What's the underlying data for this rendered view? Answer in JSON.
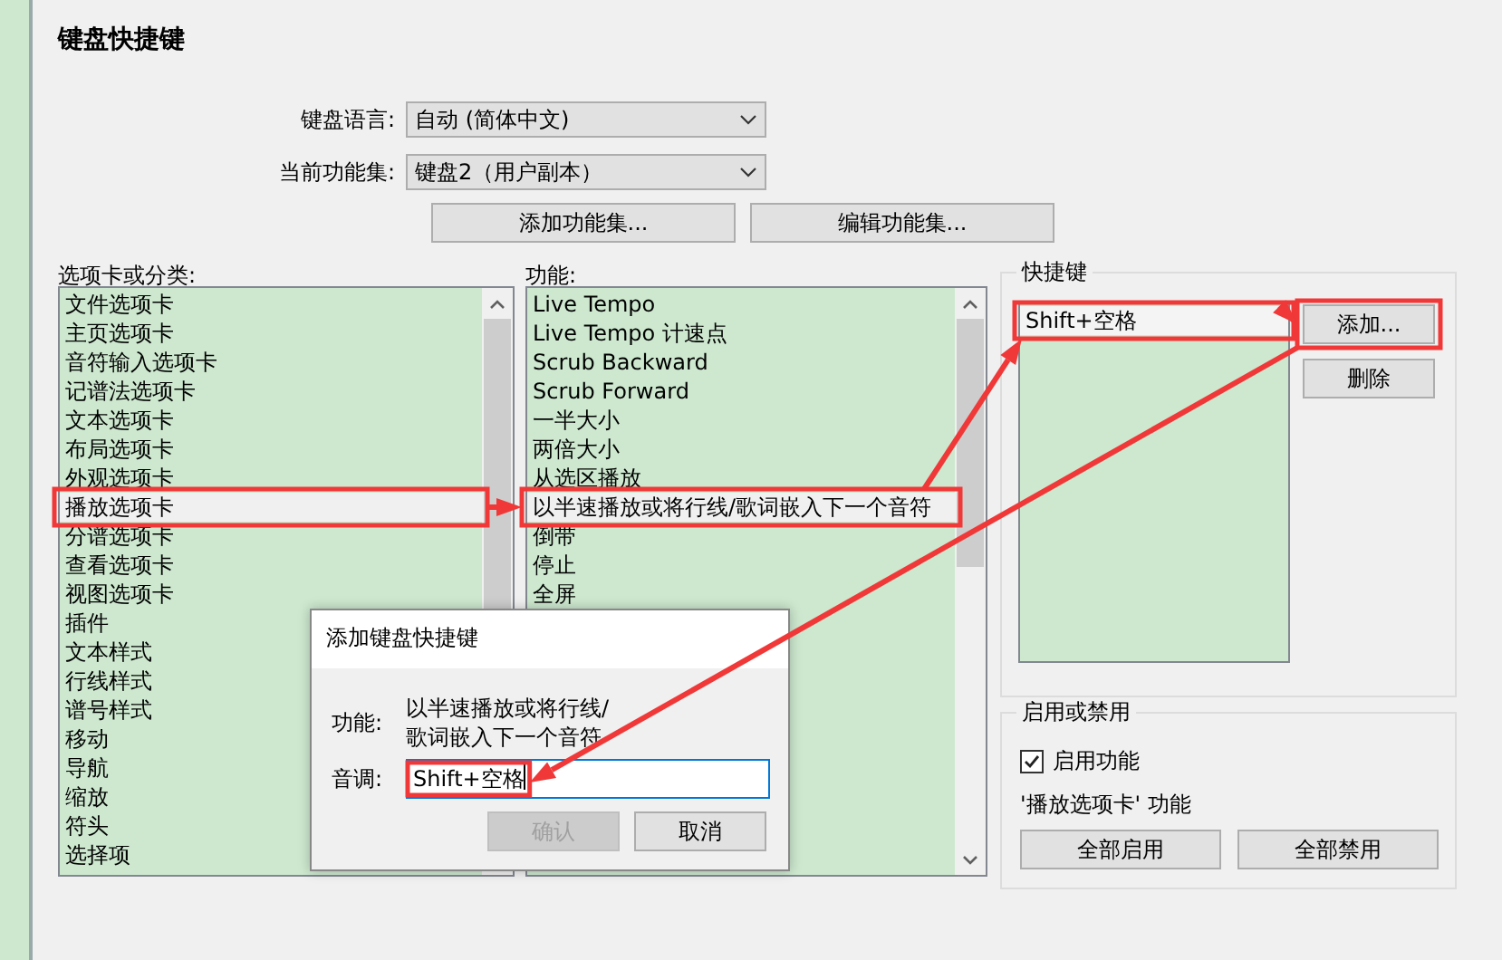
{
  "title": "键盘快捷键",
  "keyboard_language": {
    "label": "键盘语言:",
    "value": "自动 (简体中文)"
  },
  "feature_set": {
    "label": "当前功能集:",
    "value": "键盘2（用户副本）"
  },
  "feature_set_buttons": [
    "添加功能集...",
    "编辑功能集..."
  ],
  "categories": {
    "label": "选项卡或分类:",
    "items": [
      {
        "text": "文件选项卡",
        "selected": false
      },
      {
        "text": "主页选项卡",
        "selected": false
      },
      {
        "text": "音符输入选项卡",
        "selected": false
      },
      {
        "text": "记谱法选项卡",
        "selected": false
      },
      {
        "text": "文本选项卡",
        "selected": false
      },
      {
        "text": "布局选项卡",
        "selected": false
      },
      {
        "text": "外观选项卡",
        "selected": false
      },
      {
        "text": "播放选项卡",
        "selected": true,
        "highlighted": true
      },
      {
        "text": "分谱选项卡",
        "selected": false
      },
      {
        "text": "查看选项卡",
        "selected": false
      },
      {
        "text": "视图选项卡",
        "selected": false
      },
      {
        "text": "插件",
        "selected": false
      },
      {
        "text": "文本样式",
        "selected": false
      },
      {
        "text": "行线样式",
        "selected": false
      },
      {
        "text": "谱号样式",
        "selected": false
      },
      {
        "text": "移动",
        "selected": false
      },
      {
        "text": "导航",
        "selected": false
      },
      {
        "text": "缩放",
        "selected": false
      },
      {
        "text": "符头",
        "selected": false
      },
      {
        "text": "选择项",
        "selected": false
      }
    ]
  },
  "functions": {
    "label": "功能:",
    "items": [
      {
        "text": "Live Tempo",
        "selected": false
      },
      {
        "text": "Live Tempo 计速点",
        "selected": false
      },
      {
        "text": "Scrub Backward",
        "selected": false
      },
      {
        "text": "Scrub Forward",
        "selected": false
      },
      {
        "text": "一半大小",
        "selected": false
      },
      {
        "text": "两倍大小",
        "selected": false
      },
      {
        "text": "从选区播放",
        "selected": false
      },
      {
        "text": "以半速播放或将行线/歌词嵌入下一个音符",
        "selected": true,
        "highlighted": true
      },
      {
        "text": "倒带",
        "selected": false
      },
      {
        "text": "停止",
        "selected": false
      },
      {
        "text": "全屏",
        "selected": false
      }
    ]
  },
  "shortcuts": {
    "label": "快捷键",
    "items": [
      {
        "text": "Shift+空格",
        "selected": true,
        "highlighted": true
      }
    ],
    "buttons": [
      {
        "label": "添加...",
        "highlighted": true
      },
      {
        "label": "删除",
        "highlighted": false
      }
    ]
  },
  "enable": {
    "label": "启用或禁用",
    "checkbox": {
      "label": "启用功能",
      "checked": true
    },
    "note": "'播放选项卡' 功能",
    "buttons": [
      "全部启用",
      "全部禁用"
    ]
  },
  "dialog": {
    "title": "添加键盘快捷键",
    "function_label": "功能:",
    "function_value_lines": [
      "以半速播放或将行线/",
      "歌词嵌入下一个音符"
    ],
    "key_label": "音调:",
    "key_value": "Shift+空格",
    "key_value_highlighted": true,
    "buttons": [
      {
        "label": "确认",
        "disabled": true
      },
      {
        "label": "取消",
        "disabled": false
      }
    ]
  },
  "annotation_arrows_between_highlights": true
}
